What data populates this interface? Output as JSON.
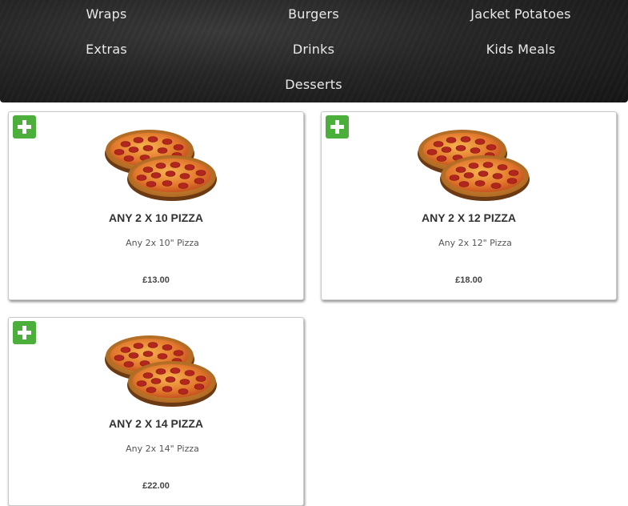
{
  "nav": {
    "items": [
      "Wraps",
      "Burgers",
      "Jacket Potatoes",
      "Extras",
      "Drinks",
      "Kids Meals",
      "Desserts"
    ]
  },
  "products": [
    {
      "title": "ANY 2 X 10 PIZZA",
      "description": "Any 2x 10\" Pizza",
      "price": "£13.00"
    },
    {
      "title": "ANY 2 X 12 PIZZA",
      "description": "Any 2x 12\" Pizza",
      "price": "£18.00"
    },
    {
      "title": "ANY 2 X 14 PIZZA",
      "description": "Any 2x 14\" Pizza",
      "price": "£22.00"
    }
  ],
  "colors": {
    "nav_background": "#262626",
    "nav_text": "#e9e9e9",
    "add_button": "#4caf3c",
    "title_text": "#333333"
  },
  "icons": {
    "add": "plus-icon",
    "product_image": "pizza-image"
  }
}
